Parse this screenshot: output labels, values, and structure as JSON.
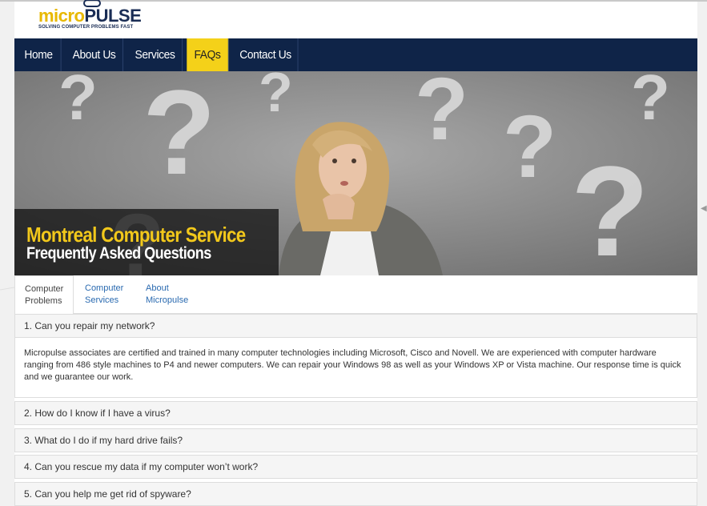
{
  "logo": {
    "text_a": "micro",
    "text_b": "PULSE",
    "tagline": "SOLVING COMPUTER PROBLEMS FAST"
  },
  "nav": {
    "items": [
      {
        "label": "Home",
        "active": false
      },
      {
        "label": "About Us",
        "active": false
      },
      {
        "label": "Services",
        "active": false
      },
      {
        "label": "FAQs",
        "active": true
      },
      {
        "label": "Contact Us",
        "active": false
      }
    ]
  },
  "hero": {
    "title": "Montreal Computer Service",
    "subtitle": "Frequently Asked Questions"
  },
  "tabs": [
    {
      "line1": "Computer",
      "line2": "Problems",
      "active": true
    },
    {
      "line1": "Computer",
      "line2": "Services",
      "active": false
    },
    {
      "line1": "About",
      "line2": "Micropulse",
      "active": false
    }
  ],
  "faq": [
    {
      "question": "1. Can you repair my network?",
      "answer": "Micropulse associates are certified and trained in many computer technologies including Microsoft, Cisco and Novell. We are experienced with computer hardware ranging from 486 style machines to P4 and newer computers. We can repair your Windows 98 as well as your Windows XP or Vista machine. Our response time is quick and we guarantee our work.",
      "expanded": true
    },
    {
      "question": "2. How do I know if I have a virus?",
      "expanded": false
    },
    {
      "question": "3. What do I do if my hard drive fails?",
      "expanded": false
    },
    {
      "question": "4. Can you rescue my data if my computer won’t work?",
      "expanded": false
    },
    {
      "question": "5. Can you help me get rid of spyware?",
      "expanded": false
    }
  ],
  "colors": {
    "nav_bg": "#0f2448",
    "nav_active": "#f4d119",
    "hero_title": "#f2c81b",
    "link": "#2a6ab0"
  }
}
